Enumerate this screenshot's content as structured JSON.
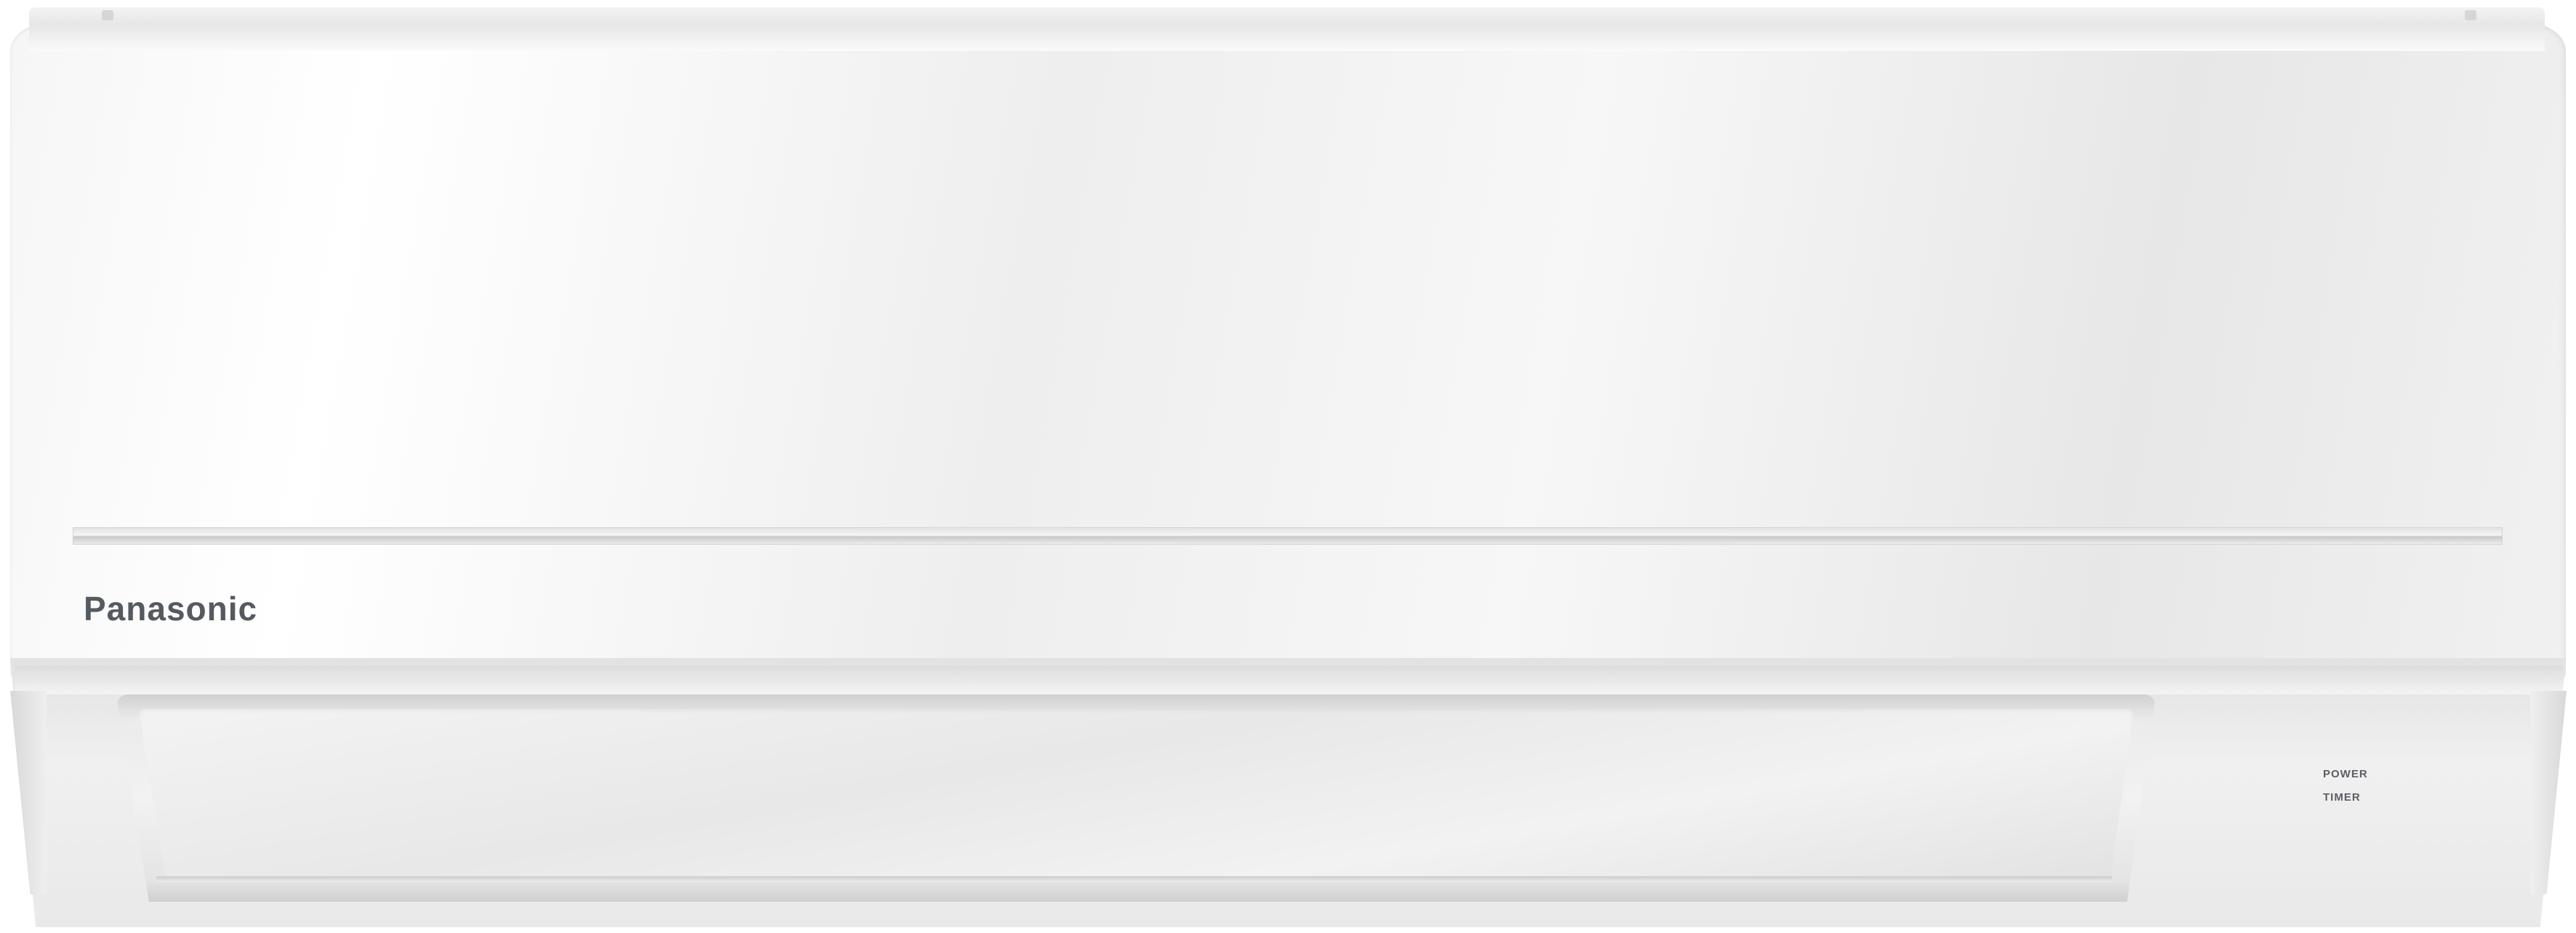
{
  "brand": {
    "logo_text": "Panasonic"
  },
  "indicators": {
    "power_label": "POWER",
    "timer_label": "TIMER"
  },
  "colors": {
    "body": "#f2f2f2",
    "logo": "#555a60",
    "accent_line": "#d0d0d0"
  }
}
